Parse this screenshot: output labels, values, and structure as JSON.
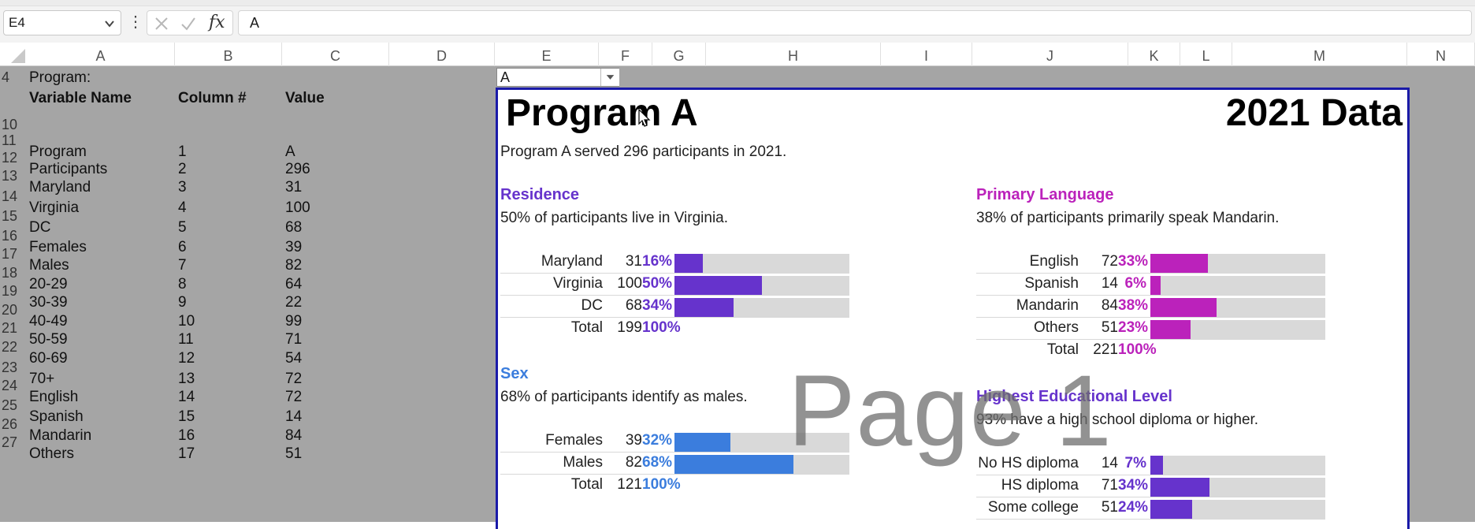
{
  "formula_bar": {
    "name_box": "E4",
    "formula": "A",
    "more_glyph": "⋮",
    "fx_label": "fx"
  },
  "columns": [
    "A",
    "B",
    "C",
    "D",
    "E",
    "F",
    "G",
    "H",
    "I",
    "J",
    "K",
    "L",
    "M",
    "N"
  ],
  "rows": {
    "numbers": [
      "4",
      "10",
      "11",
      "12",
      "13",
      "14",
      "15",
      "16",
      "17",
      "18",
      "19",
      "20",
      "21",
      "22",
      "23",
      "24",
      "25",
      "26",
      "27"
    ],
    "row4_label": "Program:",
    "header": {
      "name": "Variable Name",
      "col": "Column #",
      "value": "Value"
    },
    "data": [
      [
        "Program",
        "1",
        "A"
      ],
      [
        "Participants",
        "2",
        "296"
      ],
      [
        "Maryland",
        "3",
        "31"
      ],
      [
        "Virginia",
        "4",
        "100"
      ],
      [
        "DC",
        "5",
        "68"
      ],
      [
        "Females",
        "6",
        "39"
      ],
      [
        "Males",
        "7",
        "82"
      ],
      [
        "20-29",
        "8",
        "64"
      ],
      [
        "30-39",
        "9",
        "22"
      ],
      [
        "40-49",
        "10",
        "99"
      ],
      [
        "50-59",
        "11",
        "71"
      ],
      [
        "60-69",
        "12",
        "54"
      ],
      [
        "70+",
        "13",
        "72"
      ],
      [
        "English",
        "14",
        "72"
      ],
      [
        "Spanish",
        "15",
        "14"
      ],
      [
        "Mandarin",
        "16",
        "84"
      ],
      [
        "Others",
        "17",
        "51"
      ]
    ],
    "e4_value": "A"
  },
  "dashboard": {
    "title": "Program A",
    "year_title": "2021 Data",
    "summary": "Program A served 296 participants in 2021.",
    "watermark": "Page 1",
    "sections": [
      {
        "title": "Residence",
        "subtitle": "50% of participants live in Virginia.",
        "color": "#6633cc",
        "rows": [
          {
            "label": "Maryland",
            "count": "31",
            "pct": "16%",
            "share": 0.16
          },
          {
            "label": "Virginia",
            "count": "100",
            "pct": "50%",
            "share": 0.5
          },
          {
            "label": "DC",
            "count": "68",
            "pct": "34%",
            "share": 0.34
          }
        ],
        "total": {
          "label": "Total",
          "count": "199",
          "pct": "100%"
        }
      },
      {
        "title": "Primary Language",
        "subtitle": "38% of participants primarily speak Mandarin.",
        "color": "#bb22bb",
        "rows": [
          {
            "label": "English",
            "count": "72",
            "pct": "33%",
            "share": 0.33
          },
          {
            "label": "Spanish",
            "count": "14",
            "pct": "6%",
            "share": 0.06
          },
          {
            "label": "Mandarin",
            "count": "84",
            "pct": "38%",
            "share": 0.38
          },
          {
            "label": "Others",
            "count": "51",
            "pct": "23%",
            "share": 0.23
          }
        ],
        "total": {
          "label": "Total",
          "count": "221",
          "pct": "100%"
        }
      },
      {
        "title": "Sex",
        "subtitle": "68% of participants identify as males.",
        "color": "#3b7ddd",
        "rows": [
          {
            "label": "Females",
            "count": "39",
            "pct": "32%",
            "share": 0.32
          },
          {
            "label": "Males",
            "count": "82",
            "pct": "68%",
            "share": 0.68
          }
        ],
        "total": {
          "label": "Total",
          "count": "121",
          "pct": "100%"
        }
      },
      {
        "title": "Highest Educational Level",
        "subtitle": "93% have a high school diploma or higher.",
        "color": "#6633cc",
        "rows": [
          {
            "label": "No HS diploma",
            "count": "14",
            "pct": "7%",
            "share": 0.07
          },
          {
            "label": "HS diploma",
            "count": "71",
            "pct": "34%",
            "share": 0.34
          },
          {
            "label": "Some college",
            "count": "51",
            "pct": "24%",
            "share": 0.24
          }
        ]
      }
    ]
  },
  "colors": {
    "grid_gray": "#a5a5a5",
    "dashboard_border": "#1a1aa8",
    "bar_track": "#d9d9d9"
  }
}
